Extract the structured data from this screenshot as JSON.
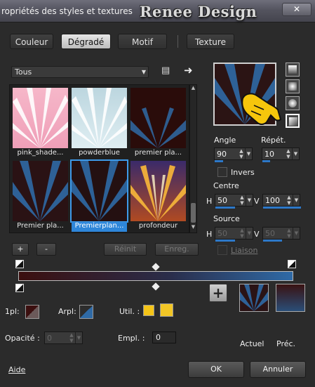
{
  "window": {
    "title": "ropriétés des styles et textures",
    "watermark": "Renee Design",
    "close_label": "✕"
  },
  "tabs": [
    {
      "label": "Couleur",
      "active": false
    },
    {
      "label": "Dégradé",
      "active": true
    },
    {
      "label": "Motif",
      "active": false
    },
    {
      "label": "Texture",
      "active": false
    }
  ],
  "preset_select": {
    "value": "Tous"
  },
  "presets": [
    {
      "label": "pink_shade...",
      "style": "pink"
    },
    {
      "label": "powderblue",
      "style": "powder"
    },
    {
      "label": "premier pla...",
      "style": "dark-rays"
    },
    {
      "label": "Premier pla...",
      "style": "blue-rays"
    },
    {
      "label": "Premierplan...",
      "style": "blue-rays-center",
      "selected": true
    },
    {
      "label": "profondeur",
      "style": "fire"
    }
  ],
  "buttons": {
    "add": "+",
    "remove": "-",
    "reset": "Réinit",
    "save": "Enreg."
  },
  "angle": {
    "label": "Angle",
    "value": "90"
  },
  "repeat": {
    "label": "Répét.",
    "value": "10"
  },
  "invert": {
    "label": "Invers",
    "checked": false
  },
  "centre": {
    "label": "Centre",
    "h_label": "H",
    "h_value": "50",
    "v_label": "V",
    "v_value": "100"
  },
  "source": {
    "label": "Source",
    "h_label": "H",
    "h_value": "50",
    "v_label": "V",
    "v_value": "50",
    "link_label": "Liaison"
  },
  "stops": {
    "fg_label": "1pl:",
    "bg_label": "Arpl:",
    "user_label": "Util. :",
    "opacity_label": "Opacité :",
    "opacity_value": "0",
    "location_label": "Empl. :",
    "location_value": "0"
  },
  "colors": {
    "foreground": "#3b0f0f",
    "background": "#2f6aa6",
    "user1": "#f5c518",
    "user2": "#f2c626",
    "accent": "#2e86d9"
  },
  "swatches": {
    "current_label": "Actuel",
    "previous_label": "Préc."
  },
  "footer": {
    "help": "Aide",
    "ok": "OK",
    "cancel": "Annuler"
  }
}
